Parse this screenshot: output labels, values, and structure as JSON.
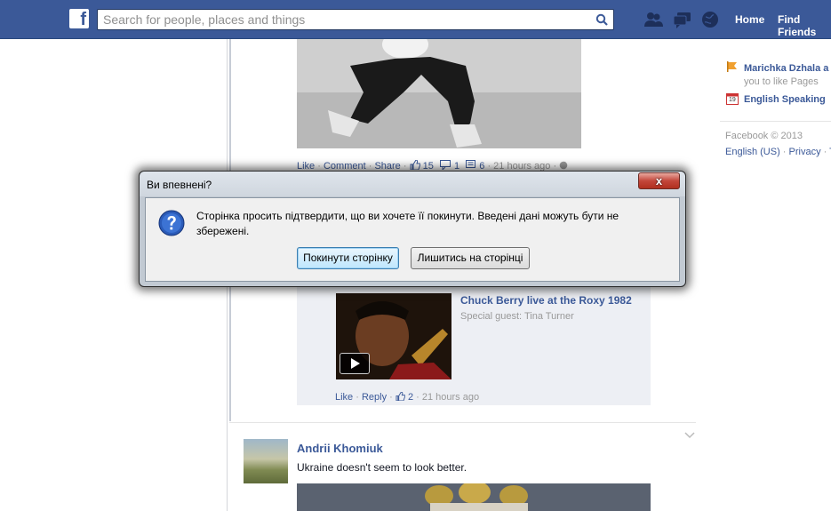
{
  "topbar": {
    "logo_letter": "f",
    "search_placeholder": "Search for people, places and things",
    "nav": {
      "home": "Home",
      "find_friends": "Find Friends"
    },
    "jewels": [
      "friend-requests-icon",
      "messages-icon",
      "notifications-globe-icon"
    ]
  },
  "feed": {
    "post1_actions": {
      "like": "Like",
      "comment": "Comment",
      "share": "Share",
      "likes": "15",
      "shares": "1",
      "comments": "6",
      "time": "21 hours ago"
    },
    "shared_video": {
      "title": "Chuck Berry live at the Roxy 1982",
      "subtitle": "Special guest: Tina Turner",
      "reply_actions": {
        "like": "Like",
        "reply": "Reply",
        "likes": "2",
        "time": "21 hours ago"
      }
    },
    "post2": {
      "author": "Andrii Khomiuk",
      "text": "Ukraine doesn't seem to look better."
    }
  },
  "right_column": {
    "item1_name": "Marichka Dzhala a",
    "item1_sub": "you to like Pages",
    "item2_name": "English Speaking",
    "calendar_day": "19",
    "copyright": "Facebook © 2013",
    "links": [
      "English (US)",
      "Privacy",
      "T"
    ]
  },
  "dialog": {
    "title": "Ви впевнені?",
    "close_label": "x",
    "message": "Сторінка просить підтвердити, що ви хочете її покинути.  Введені дані можуть бути не збережені.",
    "leave_button": "Покинути сторінку",
    "stay_button": "Лишитись на сторінці"
  },
  "colors": {
    "brand": "#3b5998",
    "link": "#3b5998",
    "muted": "#999999"
  }
}
